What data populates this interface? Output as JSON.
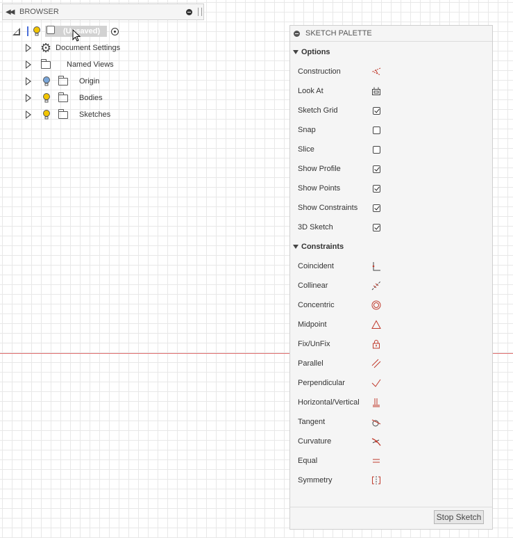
{
  "browser": {
    "title": "BROWSER",
    "root_label": "(Unsaved)",
    "items": [
      {
        "label": "Document Settings",
        "icon": "gear-icon"
      },
      {
        "label": "Named Views",
        "icon": "folder-icon"
      },
      {
        "label": "Origin",
        "icon": "folder-icon",
        "bulb": "off"
      },
      {
        "label": "Bodies",
        "icon": "folder-icon",
        "bulb": "on"
      },
      {
        "label": "Sketches",
        "icon": "folder-icon",
        "bulb": "on"
      }
    ]
  },
  "palette": {
    "title": "SKETCH PALETTE",
    "options_heading": "Options",
    "options": [
      {
        "label": "Construction",
        "control": "construction-icon"
      },
      {
        "label": "Look At",
        "control": "look-at-icon"
      },
      {
        "label": "Sketch Grid",
        "control": "checkbox",
        "checked": true
      },
      {
        "label": "Snap",
        "control": "checkbox",
        "checked": false
      },
      {
        "label": "Slice",
        "control": "checkbox",
        "checked": false
      },
      {
        "label": "Show Profile",
        "control": "checkbox",
        "checked": true
      },
      {
        "label": "Show Points",
        "control": "checkbox",
        "checked": true
      },
      {
        "label": "Show Constraints",
        "control": "checkbox",
        "checked": true
      },
      {
        "label": "3D Sketch",
        "control": "checkbox",
        "checked": true
      }
    ],
    "constraints_heading": "Constraints",
    "constraints": [
      {
        "label": "Coincident",
        "icon": "coincident-icon"
      },
      {
        "label": "Collinear",
        "icon": "collinear-icon"
      },
      {
        "label": "Concentric",
        "icon": "concentric-icon"
      },
      {
        "label": "Midpoint",
        "icon": "midpoint-icon"
      },
      {
        "label": "Fix/UnFix",
        "icon": "fix-lock-icon"
      },
      {
        "label": "Parallel",
        "icon": "parallel-icon"
      },
      {
        "label": "Perpendicular",
        "icon": "perpendicular-icon"
      },
      {
        "label": "Horizontal/Vertical",
        "icon": "horizontal-vertical-icon"
      },
      {
        "label": "Tangent",
        "icon": "tangent-icon"
      },
      {
        "label": "Curvature",
        "icon": "curvature-icon"
      },
      {
        "label": "Equal",
        "icon": "equal-icon"
      },
      {
        "label": "Symmetry",
        "icon": "symmetry-icon"
      }
    ],
    "stop_label": "Stop Sketch"
  },
  "colors": {
    "accent": "#c0392b",
    "bulb_on": "#f2c500",
    "bulb_off": "#7aa6d9",
    "axis": "#e07070"
  }
}
